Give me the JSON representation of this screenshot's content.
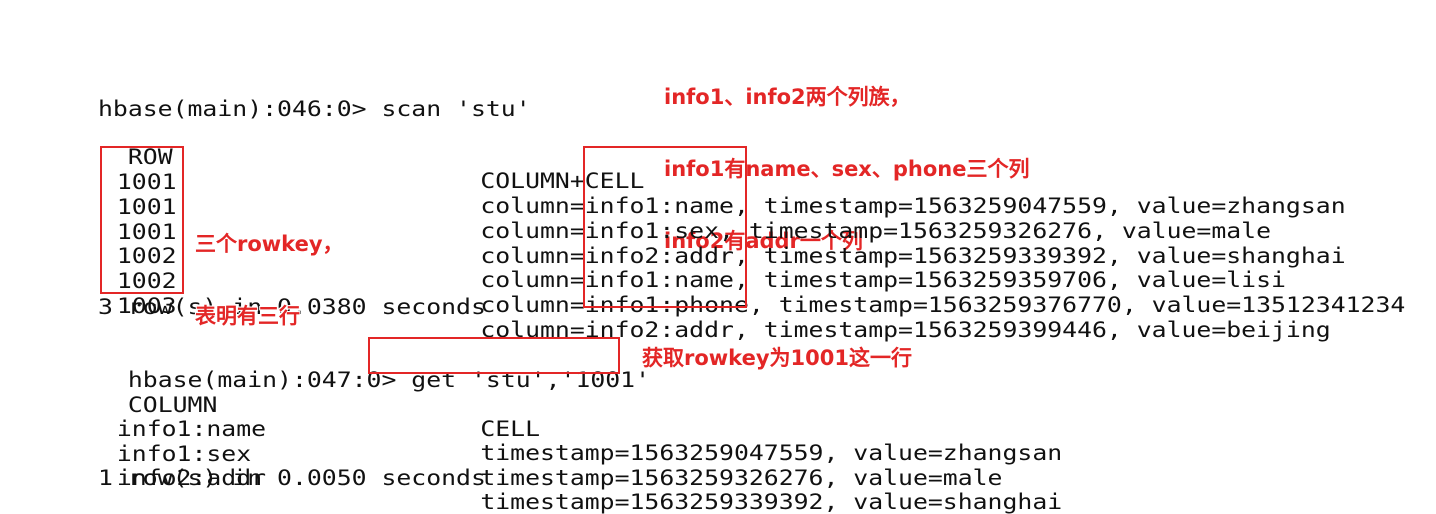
{
  "scan": {
    "prompt": "hbase(main):046:0> scan 'stu'",
    "header_row": "ROW",
    "header_cell": "COLUMN+CELL",
    "rows": [
      {
        "key": "1001",
        "cell": "column=info1:name, timestamp=1563259047559, value=zhangsan"
      },
      {
        "key": "1001",
        "cell": "column=info1:sex, timestamp=1563259326276, value=male"
      },
      {
        "key": "1001",
        "cell": "column=info2:addr, timestamp=1563259339392, value=shanghai"
      },
      {
        "key": "1002",
        "cell": "column=info1:name, timestamp=1563259359706, value=lisi"
      },
      {
        "key": "1002",
        "cell": "column=info1:phone, timestamp=1563259376770, value=13512341234"
      },
      {
        "key": "1003",
        "cell": "column=info2:addr, timestamp=1563259399446, value=beijing"
      }
    ],
    "summary": "3 row(s) in 0.0380 seconds"
  },
  "get": {
    "prompt_prefix": "hbase(main):047:0> ",
    "command": "get 'stu','1001'",
    "header_column": "COLUMN",
    "header_cell": "CELL",
    "rows": [
      {
        "column": "info1:name",
        "cell": "timestamp=1563259047559, value=zhangsan"
      },
      {
        "column": "info1:sex",
        "cell": "timestamp=1563259326276, value=male"
      },
      {
        "column": "info2:addr",
        "cell": "timestamp=1563259339392, value=shanghai"
      }
    ],
    "summary": "1 row(s) in 0.0050 seconds"
  },
  "annotations": {
    "families_lines": [
      "info1、info2两个列族，",
      "info1有name、sex、phone三个列",
      "info2有addr一个列"
    ],
    "rowkey_lines": [
      "三个rowkey，",
      "表明有三行"
    ],
    "get_note": "获取rowkey为1001这一行"
  },
  "colors": {
    "annotation": "#e32626",
    "text": "#111111",
    "background": "#ffffff"
  }
}
